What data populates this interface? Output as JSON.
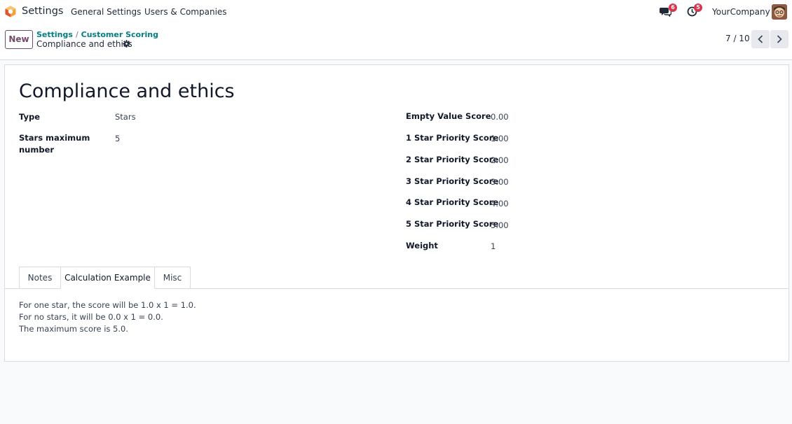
{
  "navbar": {
    "app_name": "Settings",
    "menu": [
      "General Settings",
      "Users & Companies"
    ],
    "chat_count": "6",
    "activity_count": "5",
    "company": "YourCompany"
  },
  "control_panel": {
    "new_label": "New",
    "breadcrumb": [
      "Settings",
      "Customer Scoring"
    ],
    "breadcrumb_sep": "/",
    "record_title": "Compliance and ethics",
    "pager": "7 / 10"
  },
  "form": {
    "title": "Compliance and ethics",
    "left_fields": [
      {
        "label": "Type",
        "value": "Stars"
      },
      {
        "label": "Stars maximum number",
        "value": "5"
      }
    ],
    "right_fields": [
      {
        "label": "Empty Value Score",
        "value": "0.00"
      },
      {
        "label": "1 Star Priority Score",
        "value": "1.00"
      },
      {
        "label": "2 Star Priority Score",
        "value": "2.00"
      },
      {
        "label": "3 Star Priority Score",
        "value": "3.00"
      },
      {
        "label": "4 Star Priority Score",
        "value": "4.00"
      },
      {
        "label": "5 Star Priority Score",
        "value": "5.00"
      },
      {
        "label": "Weight",
        "value": "1"
      }
    ]
  },
  "notebook": {
    "tabs": [
      "Notes",
      "Calculation Example",
      "Misc"
    ],
    "active_tab": "Calculation Example",
    "content": [
      "For one star, the score will be 1.0 x 1 = 1.0.",
      "For no stars, it will be 0.0 x 1 = 0.0.",
      "The maximum score is 5.0."
    ]
  },
  "colors": {
    "brand": "#714b67",
    "link": "#017e84",
    "badge": "#d9344d"
  }
}
